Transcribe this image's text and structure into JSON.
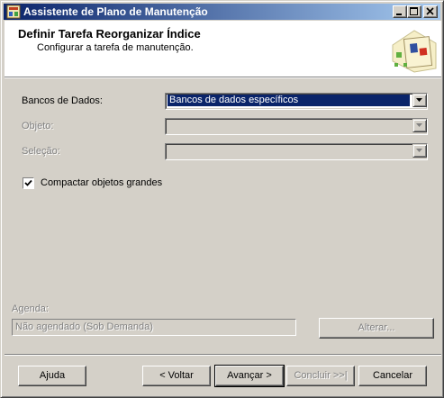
{
  "window": {
    "title": "Assistente de Plano de Manutenção"
  },
  "header": {
    "title": "Definir Tarefa Reorganizar Índice",
    "subtitle": "Configurar a tarefa de manutenção."
  },
  "form": {
    "databases_label": "Bancos de Dados:",
    "databases_value": "Bancos de dados específicos",
    "object_label": "Objeto:",
    "object_value": "",
    "selection_label": "Seleção:",
    "selection_value": "",
    "compact_label": "Compactar objetos grandes",
    "compact_checked": true
  },
  "schedule": {
    "label": "Agenda:",
    "value": "Não agendado (Sob Demanda)",
    "change_button": "Alterar..."
  },
  "buttons": {
    "help": "Ajuda",
    "back": "< Voltar",
    "next": "Avançar >",
    "finish": "Concluir >>|",
    "cancel": "Cancelar"
  },
  "icons": {
    "app": "maintenance-plan-icon",
    "header": "wizard-graphic-icon",
    "minimize": "minimize-icon",
    "maximize": "maximize-icon",
    "close": "close-icon",
    "dropdown": "chevron-down-icon",
    "check": "check-icon"
  },
  "colors": {
    "title_bar_start": "#0a246a",
    "title_bar_end": "#a6caf0",
    "selection": "#0a246a",
    "window_bg": "#d4d0c8"
  }
}
